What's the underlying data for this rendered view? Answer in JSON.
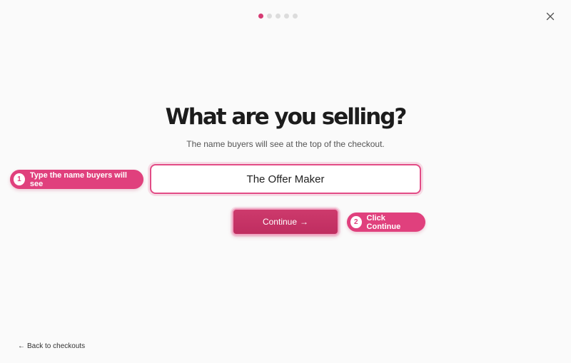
{
  "progress": {
    "total_steps": 5,
    "current_step": 1
  },
  "header": {
    "close_icon": "close-icon"
  },
  "main": {
    "title": "What are you selling?",
    "subtitle": "The name buyers will see at the top of the checkout.",
    "offer_name_value": "The Offer Maker",
    "continue_label": "Continue",
    "continue_arrow": "→"
  },
  "annotations": {
    "step1_number": "1",
    "step1_label": "Type the name buyers will see",
    "step2_number": "2",
    "step2_label": "Click Continue"
  },
  "footer": {
    "back_arrow": "←",
    "back_label": "Back to checkouts"
  },
  "colors": {
    "accent": "#e0407d",
    "button": "#c73367",
    "dot_inactive": "#dcdcdc"
  }
}
